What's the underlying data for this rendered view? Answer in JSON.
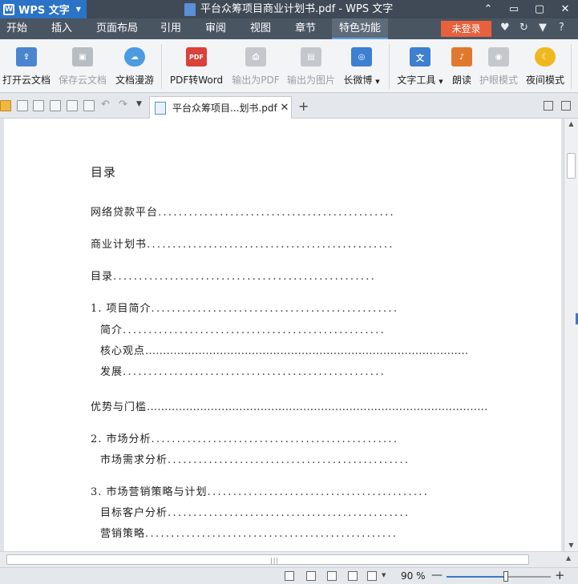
{
  "window": {
    "app_name": "WPS 文字",
    "doc_title": "平台众筹项目商业计划书.pdf - WPS 文字",
    "controls": [
      "⌃",
      "▭",
      "▢",
      "✕"
    ]
  },
  "menu": {
    "tabs": [
      "开始",
      "插入",
      "页面布局",
      "引用",
      "审阅",
      "视图",
      "章节",
      "特色功能"
    ],
    "active_tab": "特色功能",
    "login_label": "未登录",
    "help_label": "?"
  },
  "ribbon": {
    "buttons": [
      {
        "label": "打开云文档",
        "icon": "cloud-open-icon",
        "enabled": true,
        "color": "#4a86cf"
      },
      {
        "label": "保存云文档",
        "icon": "cloud-save-icon",
        "enabled": false,
        "color": "#b8bdc3"
      },
      {
        "label": "文档漫游",
        "icon": "cloud-sync-icon",
        "enabled": true,
        "color": "#4a9be0"
      },
      {
        "label": "PDF转Word",
        "icon": "pdf-to-word-icon",
        "enabled": true,
        "color": "#d9413a"
      },
      {
        "label": "输出为PDF",
        "icon": "export-pdf-icon",
        "enabled": false,
        "color": "#c4c8cd"
      },
      {
        "label": "输出为图片",
        "icon": "export-image-icon",
        "enabled": false,
        "color": "#c4c8cd"
      },
      {
        "label": "长微博",
        "icon": "weibo-icon",
        "enabled": true,
        "color": "#3d7fd0",
        "dropdown": true
      },
      {
        "label": "文字工具",
        "icon": "text-tools-icon",
        "enabled": true,
        "color": "#3d7fd0",
        "dropdown": true
      },
      {
        "label": "朗读",
        "icon": "read-aloud-icon",
        "enabled": true,
        "color": "#e0782e"
      },
      {
        "label": "护眼模式",
        "icon": "eye-care-icon",
        "enabled": false,
        "color": "#c4c8cd"
      },
      {
        "label": "夜间模式",
        "icon": "night-mode-icon",
        "enabled": true,
        "color": "#f0b820"
      }
    ]
  },
  "doc_tab": {
    "name": "平台众筹项目...划书.pdf",
    "close": "✕",
    "new_tab": "+"
  },
  "document": {
    "heading": "目录",
    "entries": [
      {
        "text": "网络贷款平台",
        "dots": ".............................................."
      },
      {
        "text": "商业计划书",
        "dots": "................................................"
      },
      {
        "text": "目录",
        "dots": "..................................................."
      },
      {
        "text": "1.  项目简介",
        "dots": "................................................"
      },
      {
        "text": "简介",
        "dots": "..................................................."
      },
      {
        "text": "核心观点",
        "dots": "..........................................................................................."
      },
      {
        "text": "发展",
        "dots": "..................................................."
      },
      {
        "text": "优势与门槛",
        "dots": "................................................................................................"
      },
      {
        "text": "2.  市场分析",
        "dots": "................................................"
      },
      {
        "text": "市场需求分析",
        "dots": "..............................................."
      },
      {
        "text": "3.  市场营销策略与计划",
        "dots": "..........................................."
      },
      {
        "text": "目标客户分析",
        "dots": "..............................................."
      },
      {
        "text": "营销策略",
        "dots": "................................................."
      }
    ]
  },
  "scrollbars": {
    "h_grip": "|||"
  },
  "status": {
    "zoom_label": "90 %",
    "zoom_percent": 90,
    "zoom_minus": "—",
    "zoom_plus": "+"
  }
}
